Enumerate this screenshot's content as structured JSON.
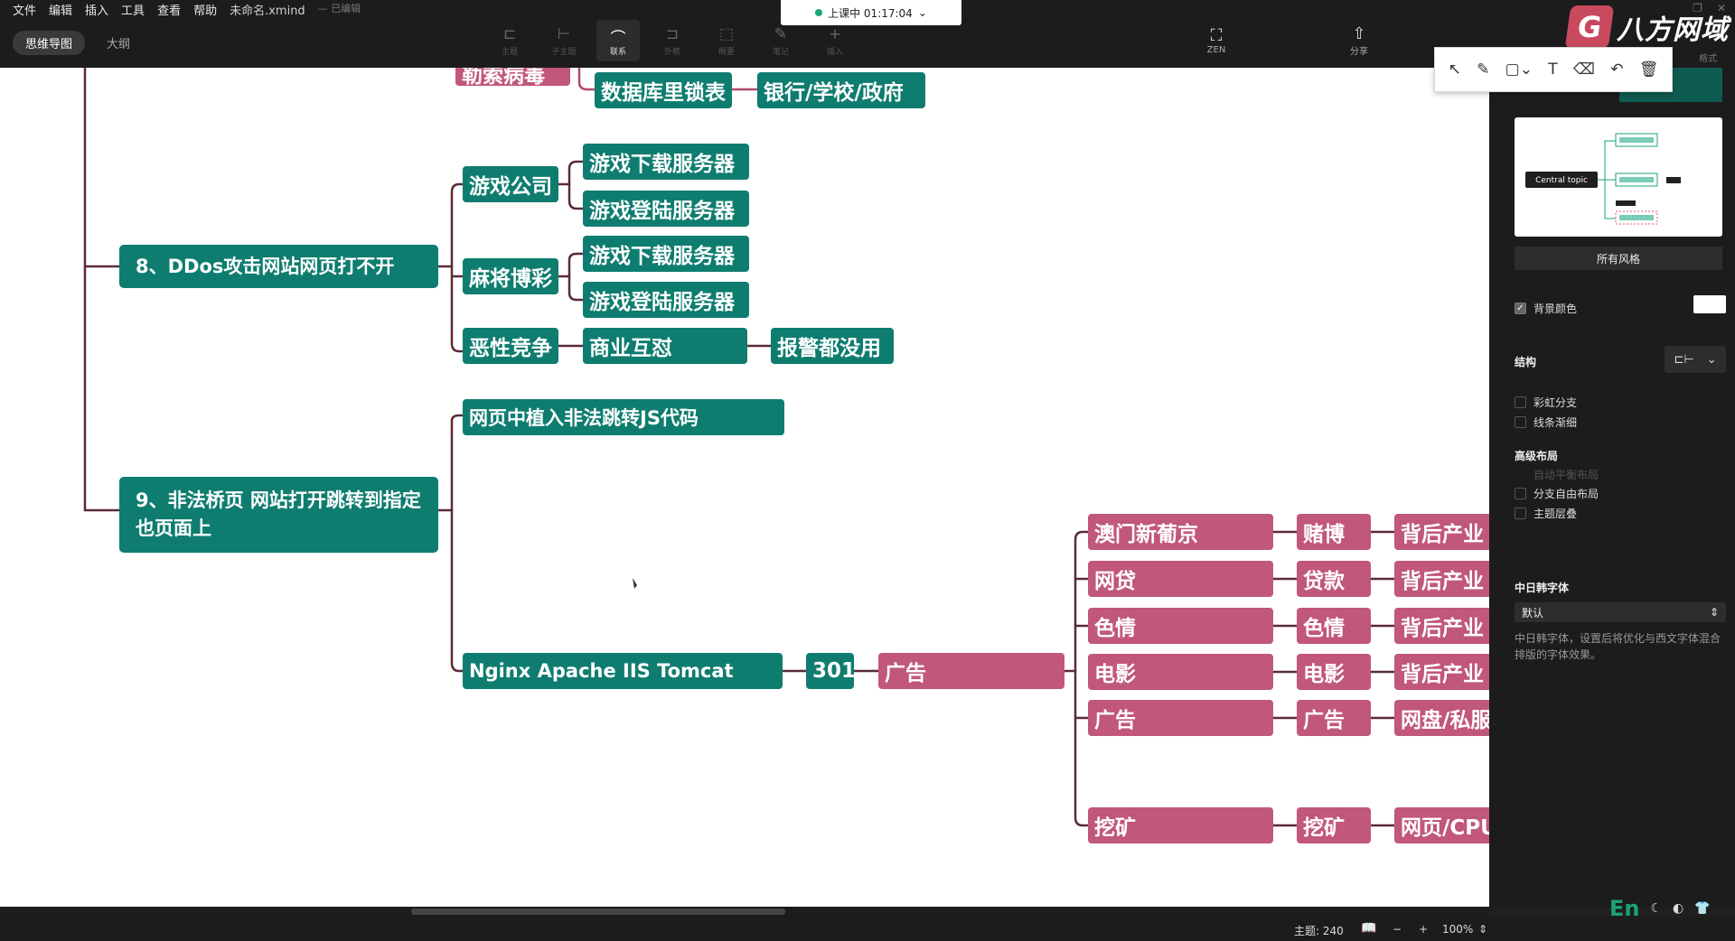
{
  "menu": [
    "文件",
    "编辑",
    "插入",
    "工具",
    "查看",
    "帮助"
  ],
  "file_name": "未命名.xmind",
  "save_state": "已编辑",
  "view_tabs": [
    "思维导图",
    "大纲"
  ],
  "toolbar": [
    "主题",
    "子主题",
    "联系",
    "外框",
    "概要",
    "笔记",
    "插入"
  ],
  "zen_label": "ZEN",
  "share_label": "分享",
  "session": "上课中 01:17:04",
  "logo_text": "八方网域",
  "format_tab": "格式",
  "nodes": {
    "partial_top": "勒索病毒",
    "db_lock": "数据库里锁表",
    "bank": "银行/学校/政府",
    "ddos": "8、DDos攻击网站网页打不开",
    "game_co": "游戏公司",
    "game_dl_1": "游戏下载服务器",
    "game_login_1": "游戏登陆服务器",
    "mahjong": "麻将博彩",
    "game_dl_2": "游戏下载服务器",
    "game_login_2": "游戏登陆服务器",
    "malicious": "恶性竞争",
    "business": "商业互怼",
    "police": "报警都没用",
    "bridge": "9、非法桥页 网站打开跳转到指定也页面上",
    "js_code": "网页中植入非法跳转JS代码",
    "servers": "Nginx Apache  IIS  Tomcat",
    "code_301": "301",
    "ad": "广告",
    "macau": "澳门新葡京",
    "gamble": "赌博",
    "behind_1": "背后产业",
    "loan": "网贷",
    "loan2": "贷款",
    "behind_2": "背后产业",
    "porn": "色情",
    "porn2": "色情",
    "behind_3": "背后产业",
    "movie": "电影",
    "movie2": "电影",
    "behind_4": "背后产业",
    "ad2": "广告",
    "ad3": "广告",
    "netdisk": "网盘/私服",
    "mining": "挖矿",
    "mining2": "挖矿",
    "webcpu": "网页/CPU"
  },
  "panel": {
    "preview_topic": "Central topic",
    "all_styles": "所有风格",
    "bg_color": "背景颜色",
    "structure": "结构",
    "rainbow": "彩虹分支",
    "taper": "线条渐细",
    "advanced": "高级布局",
    "auto_balance": "自动平衡布局",
    "free_layout": "分支自由布局",
    "overlap": "主题层叠",
    "cjk_font": "中日韩字体",
    "cjk_default": "默认",
    "cjk_desc": "中日韩字体，设置后将优化与西文字体混合排版的字体效果。"
  },
  "status": {
    "topic_count": "主题: 240",
    "zoom": "100%"
  },
  "bottom_en": "En"
}
